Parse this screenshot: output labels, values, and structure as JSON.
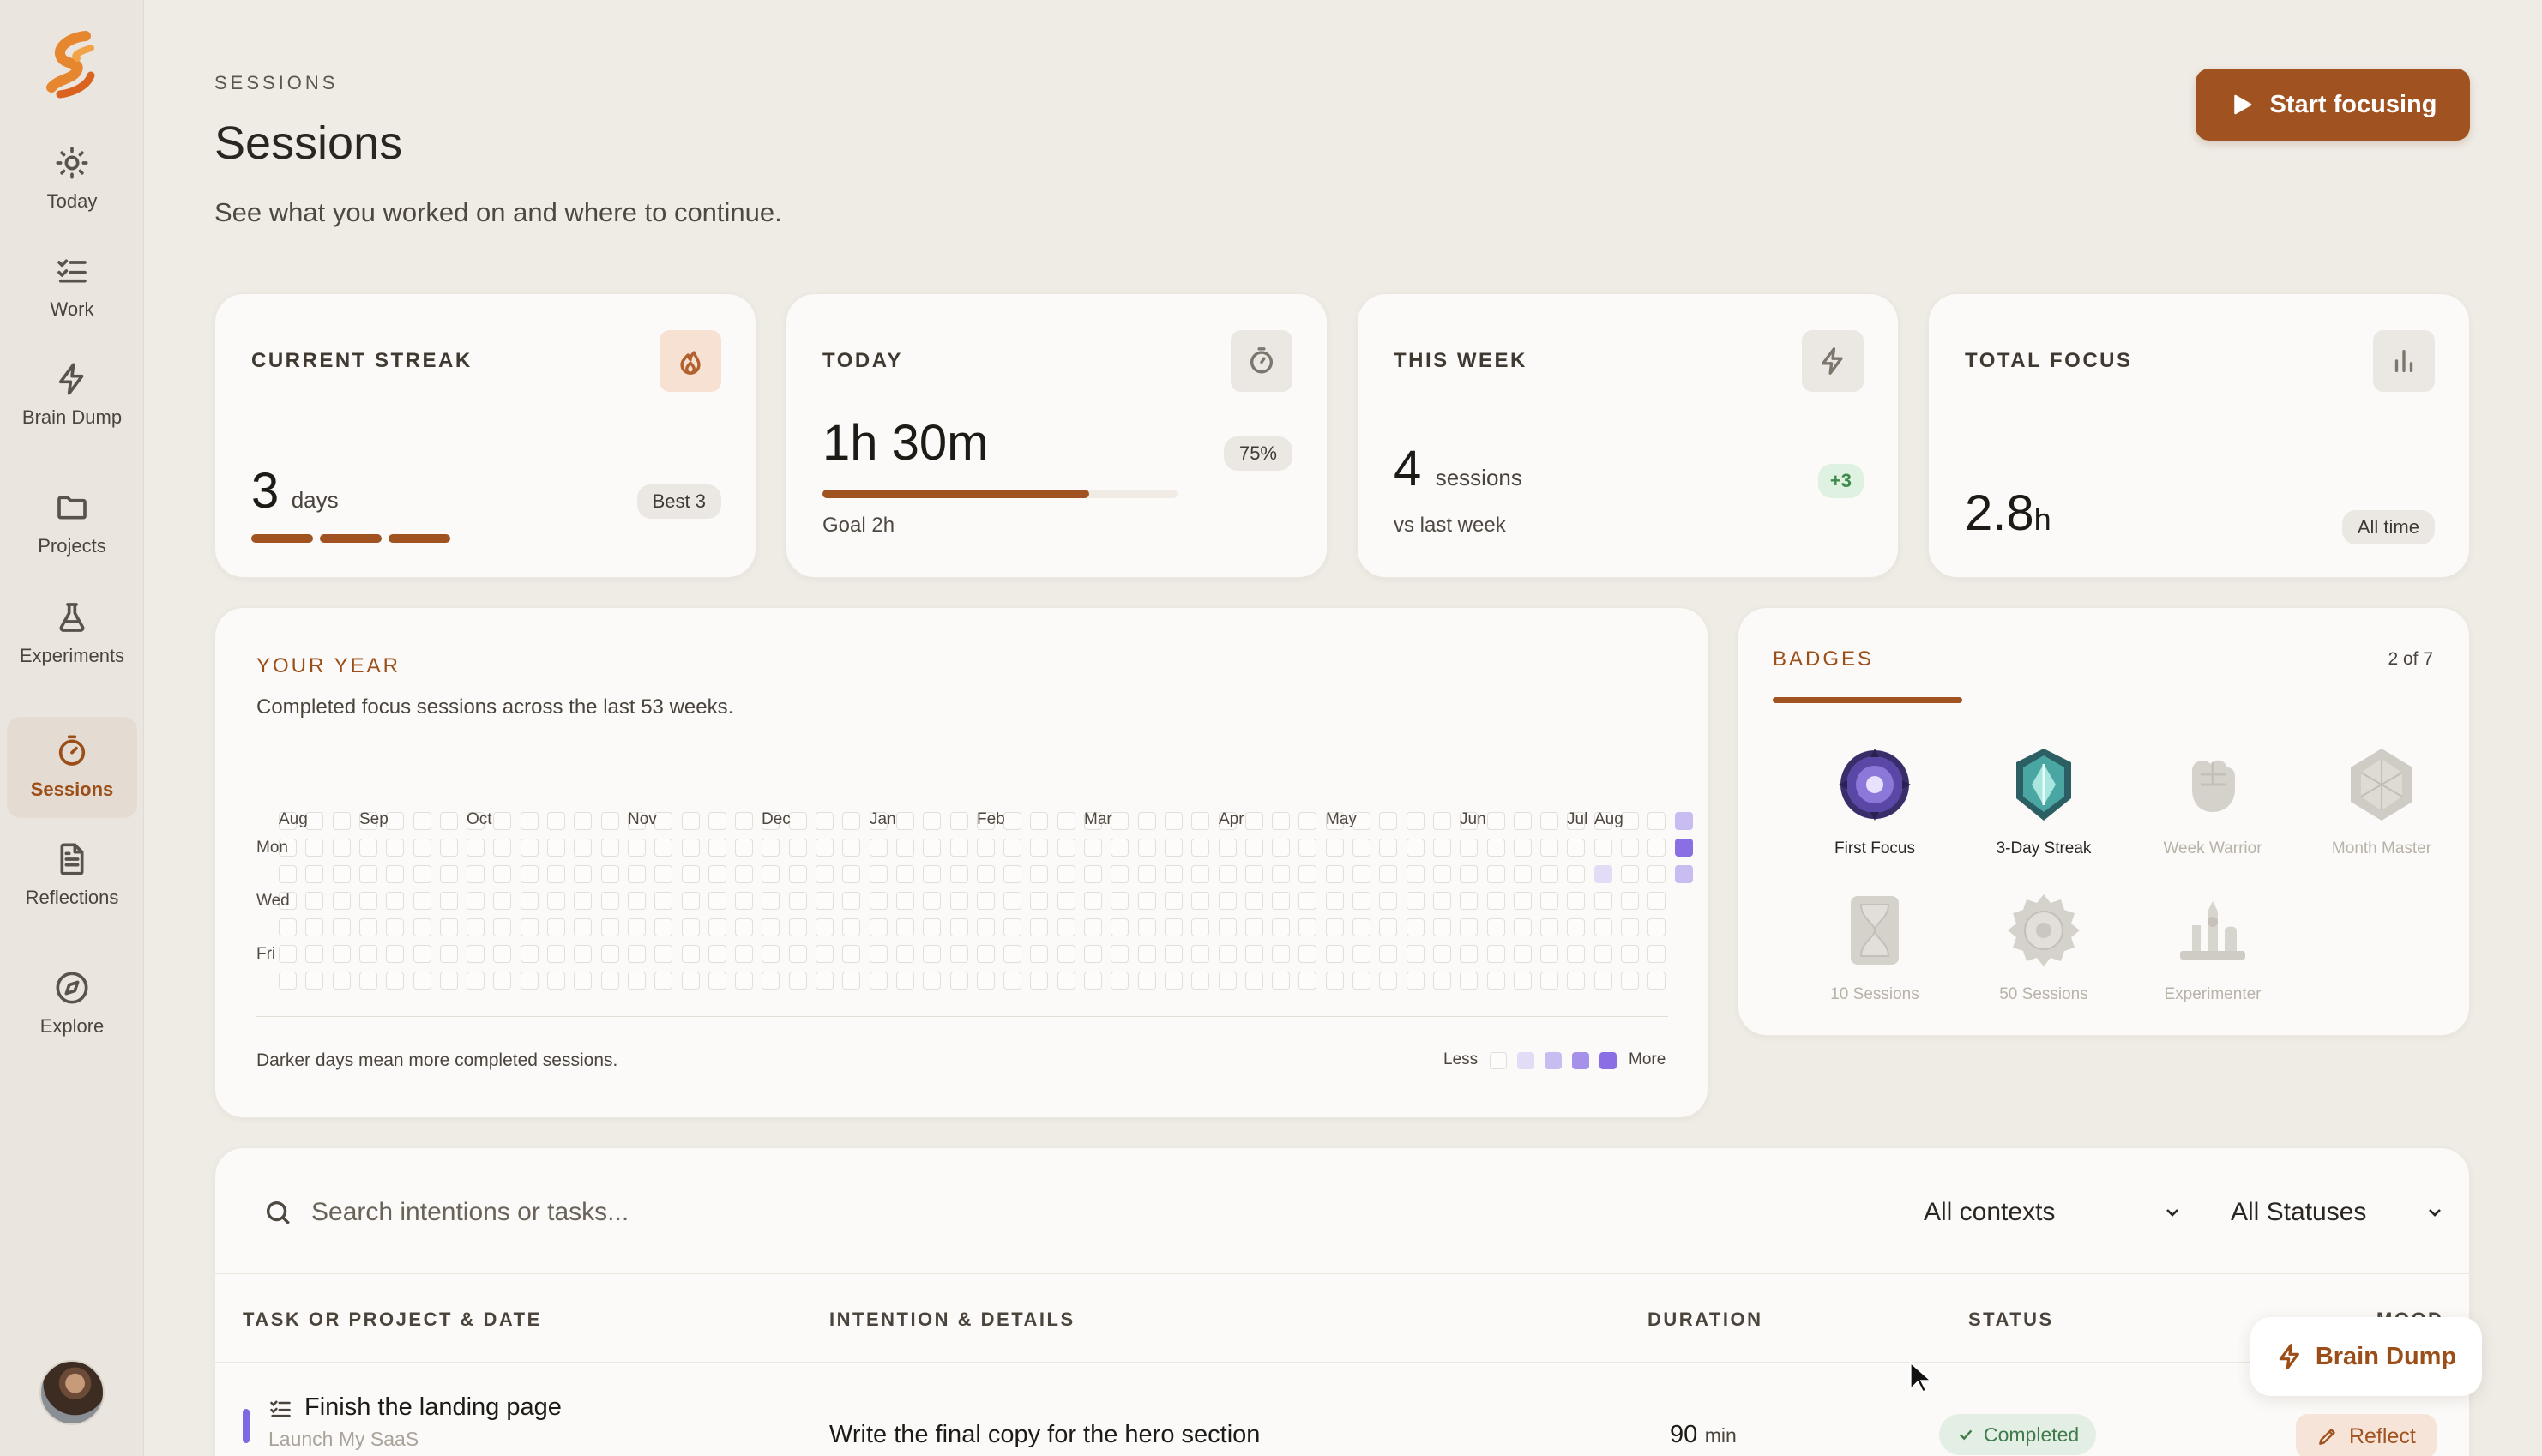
{
  "sidebar": {
    "items": [
      {
        "label": "Today",
        "icon": "sun-icon"
      },
      {
        "label": "Work",
        "icon": "checklist-icon"
      },
      {
        "label": "Brain Dump",
        "icon": "bolt-icon"
      },
      {
        "label": "Projects",
        "icon": "folder-icon"
      },
      {
        "label": "Experiments",
        "icon": "flask-icon"
      },
      {
        "label": "Sessions",
        "icon": "timer-icon",
        "active": true
      },
      {
        "label": "Reflections",
        "icon": "document-icon"
      },
      {
        "label": "Explore",
        "icon": "compass-icon"
      }
    ]
  },
  "header": {
    "eyebrow": "SESSIONS",
    "title": "Sessions",
    "subtitle": "See what you worked on and where to continue.",
    "start_button": "Start focusing"
  },
  "stats": {
    "streak": {
      "label": "CURRENT STREAK",
      "value": "3",
      "unit": "days",
      "pill": "Best 3",
      "icon": "flame-icon",
      "filled_segments": 3
    },
    "today": {
      "label": "TODAY",
      "value": "1h 30m",
      "pill": "75%",
      "progress": 0.75,
      "note": "Goal 2h",
      "icon": "stopwatch-icon"
    },
    "week": {
      "label": "THIS WEEK",
      "value": "4",
      "unit": "sessions",
      "pill": "+3",
      "note": "vs last week",
      "icon": "bolt-icon"
    },
    "total": {
      "label": "TOTAL FOCUS",
      "value": "2.8",
      "unit": "h",
      "pill": "All time",
      "icon": "bar-chart-icon"
    }
  },
  "year": {
    "label": "YOUR YEAR",
    "description": "Completed focus sessions across the last 53 weeks.",
    "months": [
      "Aug",
      "Sep",
      "Oct",
      "Nov",
      "Dec",
      "Jan",
      "Feb",
      "Mar",
      "Apr",
      "May",
      "Jun",
      "Jul",
      "Aug"
    ],
    "days": [
      "Mon",
      "Wed",
      "Fri"
    ],
    "footer": "Darker days mean more completed sessions.",
    "legend_less": "Less",
    "legend_more": "More",
    "active_cells": [
      {
        "week": 52,
        "day": 0,
        "level": 2
      },
      {
        "week": 52,
        "day": 1,
        "level": 4
      },
      {
        "week": 52,
        "day": 2,
        "level": 2
      },
      {
        "week": 49,
        "day": 2,
        "level": 1
      }
    ],
    "colors": {
      "level1": "#e3dcf6",
      "level2": "#c9bcf1",
      "level3": "#a591ea",
      "level4": "#8a6ee3"
    }
  },
  "badges": {
    "label": "BADGES",
    "count": "2 of 7",
    "progress": 0.2857,
    "items": [
      {
        "name": "First Focus",
        "unlocked": true,
        "icon": "purple-medal-icon"
      },
      {
        "name": "3-Day Streak",
        "unlocked": true,
        "icon": "teal-crystal-icon"
      },
      {
        "name": "Week Warrior",
        "unlocked": false,
        "icon": "fist-icon"
      },
      {
        "name": "Month Master",
        "unlocked": false,
        "icon": "gem-icon"
      },
      {
        "name": "10 Sessions",
        "unlocked": false,
        "icon": "hourglass-icon"
      },
      {
        "name": "50 Sessions",
        "unlocked": false,
        "icon": "cog-icon"
      },
      {
        "name": "Experimenter",
        "unlocked": false,
        "icon": "lab-icon"
      }
    ]
  },
  "table": {
    "search_placeholder": "Search intentions or tasks...",
    "context_filter": "All contexts",
    "status_filter": "All Statuses",
    "columns": [
      "TASK OR PROJECT & DATE",
      "INTENTION & DETAILS",
      "DURATION",
      "STATUS",
      "MOOD"
    ],
    "rows": [
      {
        "task": "Finish the landing page",
        "project": "Launch My SaaS",
        "intention": "Write the final copy for the hero section",
        "duration": "90",
        "duration_unit": "min",
        "status": "Completed",
        "action": "Reflect"
      }
    ]
  },
  "fab": {
    "label": "Brain Dump"
  }
}
